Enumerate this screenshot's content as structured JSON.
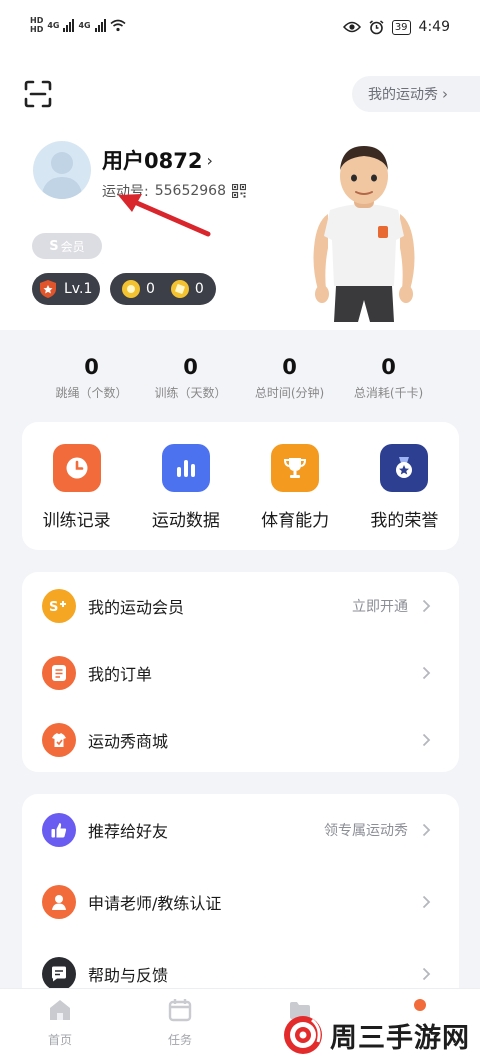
{
  "status_bar": {
    "network_left_top": "HD",
    "network_left_bottom": "HD",
    "signal_1": "4G",
    "signal_2": "4G",
    "battery": "39",
    "time": "4:49"
  },
  "header": {
    "show_button": "我的运动秀",
    "username": "用户0872",
    "user_id_label": "运动号:",
    "user_id": "55652968",
    "member_badge": "会员",
    "member_badge_mark": "S",
    "level": "Lv.1",
    "coins_1": "0",
    "coins_2": "0"
  },
  "stats": [
    {
      "value": "0",
      "label": "跳绳（个数）"
    },
    {
      "value": "0",
      "label": "训练（天数）"
    },
    {
      "value": "0",
      "label": "总时间(分钟)"
    },
    {
      "value": "0",
      "label": "总消耗(千卡)"
    }
  ],
  "quick_actions": [
    {
      "label": "训练记录",
      "color": "#f26b3a",
      "icon": "clock-icon"
    },
    {
      "label": "运动数据",
      "color": "#4d72f0",
      "icon": "bar-chart-icon"
    },
    {
      "label": "体育能力",
      "color": "#f39a1f",
      "icon": "trophy-icon"
    },
    {
      "label": "我的荣誉",
      "color": "#2d3f91",
      "icon": "medal-icon"
    }
  ],
  "menu_group_1": [
    {
      "label": "我的运动会员",
      "right": "立即开通",
      "color": "#f5a623",
      "icon": "vip-icon"
    },
    {
      "label": "我的订单",
      "right": "",
      "color": "#f26b3a",
      "icon": "order-icon"
    },
    {
      "label": "运动秀商城",
      "right": "",
      "color": "#f26b3a",
      "icon": "shop-icon"
    }
  ],
  "menu_group_2": [
    {
      "label": "推荐给好友",
      "right": "领专属运动秀",
      "color": "#6a5cf0",
      "icon": "thumbs-up-icon"
    },
    {
      "label": "申请老师/教练认证",
      "right": "",
      "color": "#f26b3a",
      "icon": "coach-icon"
    },
    {
      "label": "帮助与反馈",
      "right": "",
      "color": "#2a2b31",
      "icon": "chat-icon"
    }
  ],
  "tabbar": {
    "tab_home": "首页",
    "tab_tasks": "任务"
  },
  "watermark": "周三手游网",
  "colors": {
    "accent_orange": "#f26b3a",
    "arrow_red": "#d9262c",
    "badge_dark": "#3c3f47"
  }
}
